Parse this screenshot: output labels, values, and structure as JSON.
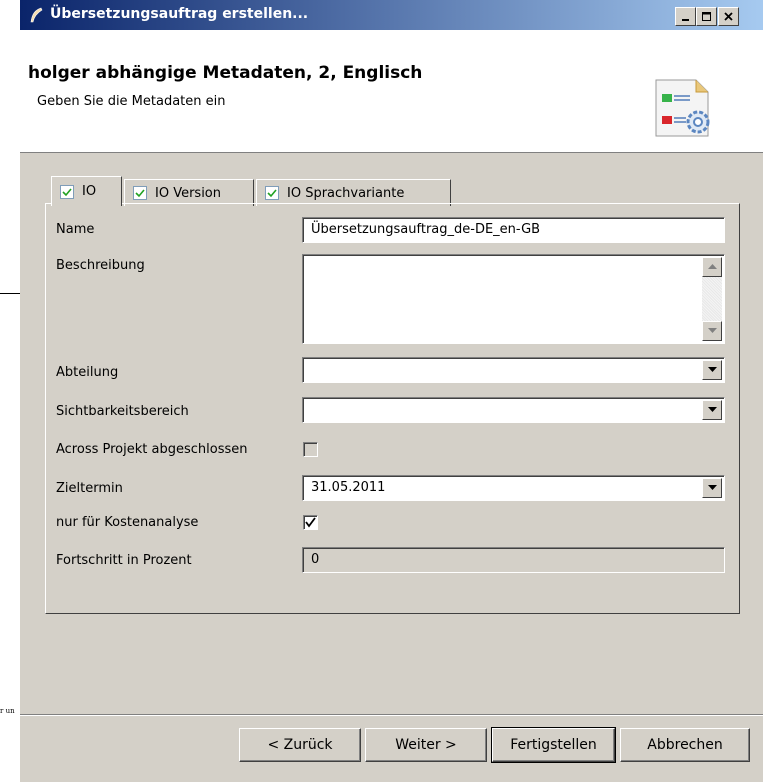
{
  "background": {
    "fragment_text": "r un"
  },
  "window": {
    "title": "Übersetzungsauftrag erstellen...",
    "controls": {
      "minimize": "_",
      "maximize": "□",
      "close": "×"
    }
  },
  "header": {
    "title": "holger abhängige Metadaten, 2, Englisch",
    "subtitle": "Geben Sie die Metadaten ein",
    "icon": "metadata-settings-icon"
  },
  "tabs": [
    {
      "label": "IO",
      "checked": true,
      "active": true
    },
    {
      "label": "IO Version",
      "checked": true,
      "active": false
    },
    {
      "label": "IO Sprachvariante",
      "checked": true,
      "active": false
    }
  ],
  "form": {
    "name": {
      "label": "Name",
      "value": "Übersetzungsauftrag_de-DE_en-GB"
    },
    "beschreibung": {
      "label": "Beschreibung",
      "value": ""
    },
    "abteilung": {
      "label": "Abteilung",
      "value": ""
    },
    "sichtbarkeit": {
      "label": "Sichtbarkeitsbereich",
      "value": ""
    },
    "across": {
      "label": "Across Projekt abgeschlossen",
      "checked": false,
      "enabled": false
    },
    "zieltermin": {
      "label": "Zieltermin",
      "value": "31.05.2011"
    },
    "kosten": {
      "label": "nur für Kostenanalyse",
      "checked": true
    },
    "fortschritt": {
      "label": "Fortschritt in Prozent",
      "value": "0",
      "enabled": false
    }
  },
  "buttons": {
    "back": "< Zurück",
    "next": "Weiter >",
    "finish": "Fertigstellen",
    "cancel": "Abbrechen"
  },
  "colors": {
    "titlebar_start": "#0a246a",
    "titlebar_end": "#a6caf0",
    "face": "#d4d0c8"
  }
}
